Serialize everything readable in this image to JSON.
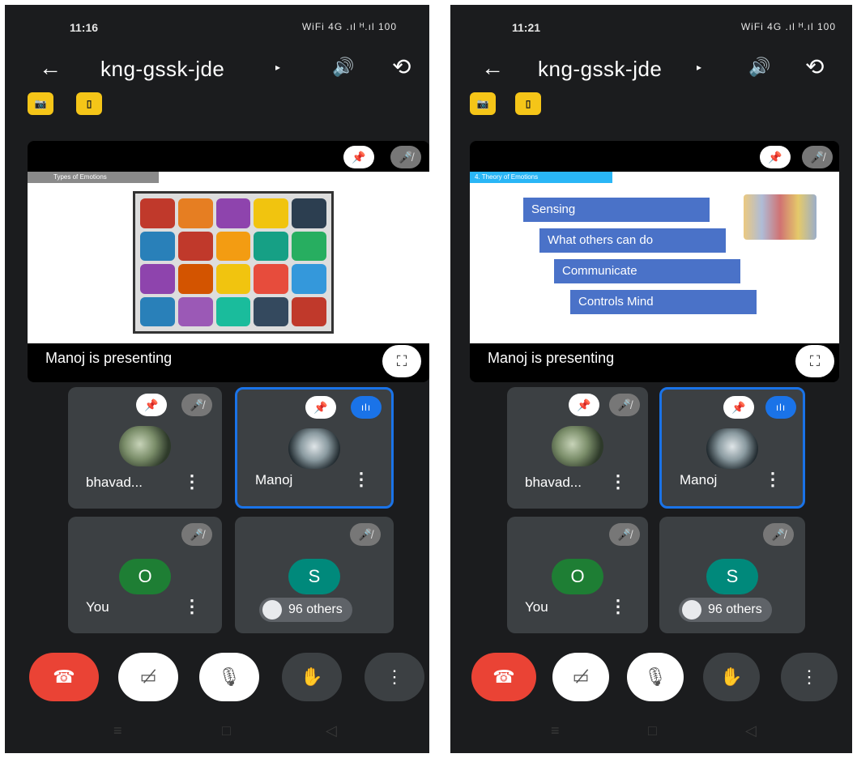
{
  "left": {
    "status": {
      "time": "11:16",
      "icons": "WiFi 4G .ıl ᴴ.ıl 100"
    },
    "header": {
      "back": "←",
      "title": "kng-gssk-jde",
      "arrow": "▸",
      "speaker": "🔊",
      "camswitch": "⟲"
    },
    "chips": [
      "📷",
      "▯"
    ],
    "presentation": {
      "slide_header": "Types of Emotions",
      "presenting": "Manoj is presenting"
    },
    "tiles": [
      {
        "name": "bhavad...",
        "dots": "⋮"
      },
      {
        "name": "Manoj",
        "dots": "⋮",
        "speaking": "ılı"
      },
      {
        "name": "You",
        "dots": "⋮",
        "letter": "O"
      },
      {
        "letter": "S",
        "others": "96 others"
      }
    ]
  },
  "right": {
    "status": {
      "time": "11:21",
      "icons": "WiFi 4G .ıl ᴴ.ıl 100"
    },
    "header": {
      "back": "←",
      "title": "kng-gssk-jde",
      "arrow": "▸",
      "speaker": "🔊",
      "camswitch": "⟲"
    },
    "chips": [
      "📷",
      "▯"
    ],
    "presentation": {
      "slide_header": "4. Theory of Emotions",
      "boxes": [
        "Sensing",
        "What others can do",
        "Communicate",
        "Controls Mind"
      ],
      "presenting": "Manoj is presenting"
    },
    "tiles": [
      {
        "name": "bhavad...",
        "dots": "⋮"
      },
      {
        "name": "Manoj",
        "dots": "⋮",
        "speaking": "ılı"
      },
      {
        "name": "You",
        "dots": "⋮",
        "letter": "O"
      },
      {
        "letter": "S",
        "others": "96 others"
      }
    ]
  },
  "icons": {
    "pin": "📌",
    "mic_off": "🎤̸",
    "fullscreen": "⛶",
    "end_call": "☎",
    "camera_off": "▭̸",
    "mic_off_btn": "🎙",
    "raise_hand": "✋",
    "more": "⋮",
    "nav_recent": "≡",
    "nav_home": "□",
    "nav_back": "◁"
  },
  "colors": {
    "accent": "#1a73e8",
    "end": "#ea4335",
    "chip": "#f5c518",
    "avatar_o": "#1e7e34",
    "avatar_s": "#00897b"
  }
}
